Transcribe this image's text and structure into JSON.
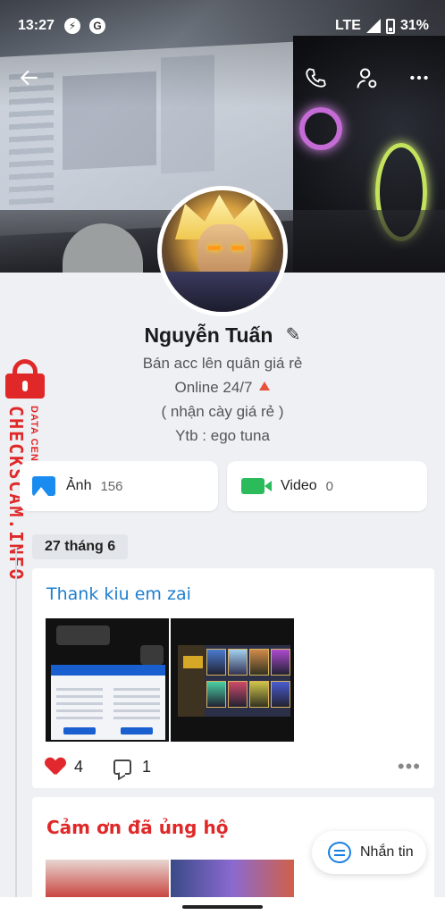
{
  "status_bar": {
    "time": "13:27",
    "app_icons": [
      "messenger-icon",
      "google-icon"
    ],
    "network": "LTE",
    "battery": "31%"
  },
  "topbar": {
    "back_icon": "back-arrow-icon",
    "actions": [
      "phone-icon",
      "user-settings-icon",
      "more-icon"
    ]
  },
  "profile": {
    "name": "Nguyễn Tuấn",
    "bio_lines": [
      "Bán acc lên quân giá rẻ",
      "Online 24/7",
      "( nhận cày giá rẻ )",
      "Ytb : ego tuna"
    ]
  },
  "watermark": {
    "title": "CHECKSCAM.INFO",
    "subtitle": "DATA CENTER"
  },
  "media": {
    "photos_label": "Ảnh",
    "photos_count": "156",
    "videos_label": "Video",
    "videos_count": "0"
  },
  "timeline": {
    "date": "27 tháng 6",
    "posts": [
      {
        "title": "Thank kiu em zai",
        "likes": "4",
        "comments": "1"
      },
      {
        "title": "Cảm ơn đã ủng hộ"
      }
    ]
  },
  "message_button": {
    "label": "Nhắn tin"
  },
  "colors": {
    "accent_blue": "#1a7fe0",
    "watermark_red": "#e02828",
    "video_green": "#2bbb5a"
  }
}
